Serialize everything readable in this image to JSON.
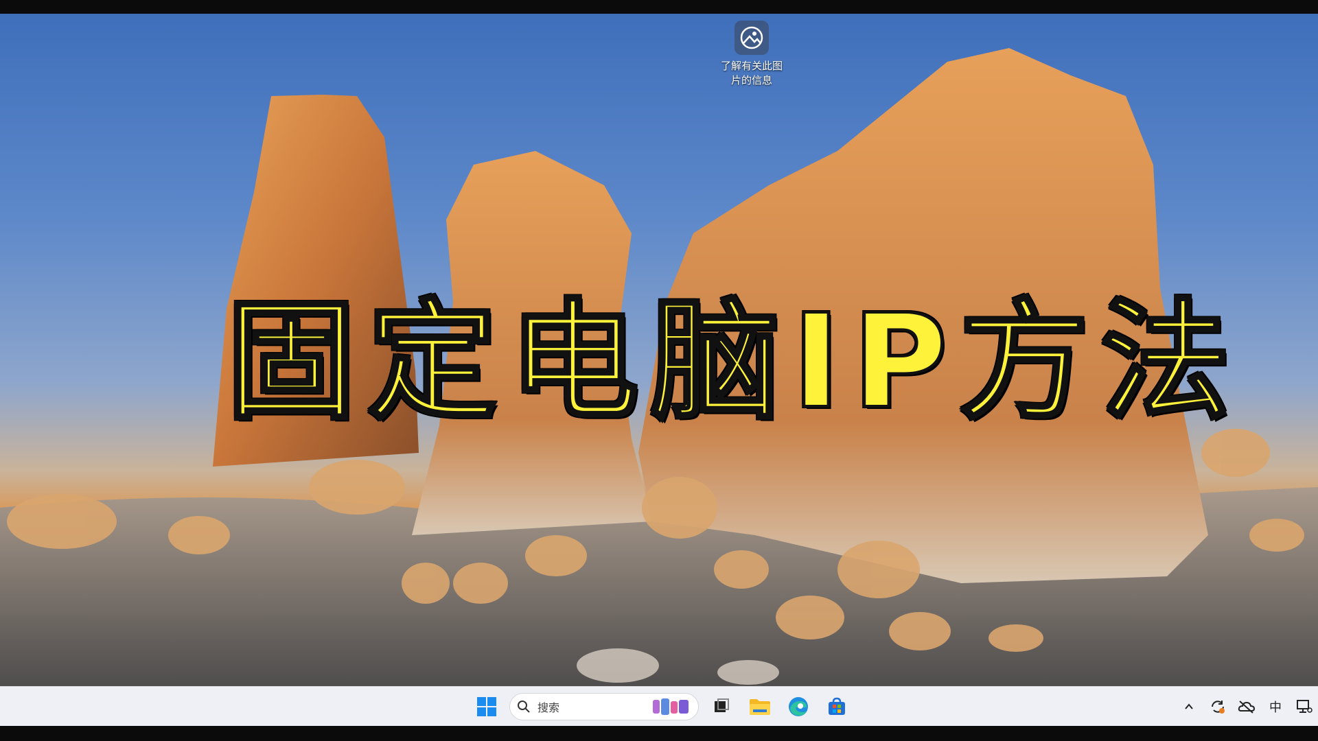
{
  "desktop": {
    "icon": {
      "name": "image-info-icon",
      "caption": "了解有关此图片的信息"
    }
  },
  "overlay": {
    "title": "固定电脑IP方法",
    "color": "#fff23a"
  },
  "taskbar": {
    "start": {
      "icon": "windows-start-icon",
      "accent": "#0078d4"
    },
    "search": {
      "placeholder": "搜索",
      "icon": "search-icon"
    },
    "pinned": [
      {
        "name": "task-view",
        "icon": "task-view-icon"
      },
      {
        "name": "file-explorer",
        "icon": "folder-icon"
      },
      {
        "name": "edge",
        "icon": "edge-icon"
      },
      {
        "name": "store",
        "icon": "store-icon"
      }
    ],
    "tray": {
      "ime_label": "中",
      "icons": [
        "chevron-up-icon",
        "sync-icon",
        "onedrive-offline-icon",
        "network-icon"
      ]
    }
  }
}
